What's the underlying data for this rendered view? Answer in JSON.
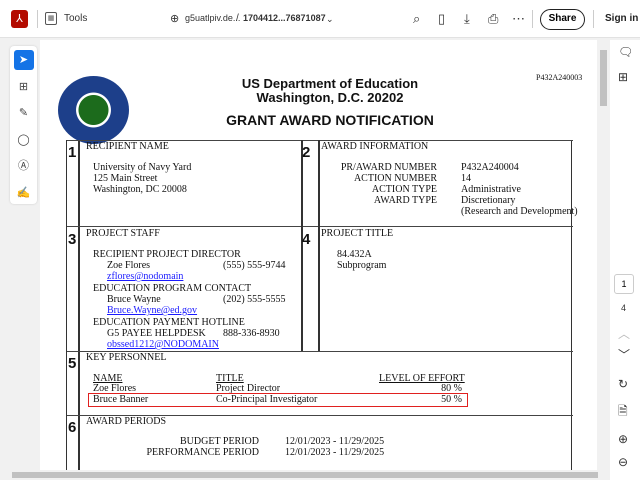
{
  "toolbar": {
    "tools_label": "Tools",
    "domain": "g5uatlpiv.de...",
    "separator": "/",
    "filename": "1704412...76871087",
    "share_label": "Share",
    "signin_label": "Sign in"
  },
  "left_tools": [
    "select",
    "add-comment",
    "draw",
    "lasso",
    "text-select",
    "sign"
  ],
  "document": {
    "code": "P432A240003",
    "agency": "US Department of Education",
    "city": "Washington, D.C. 20202",
    "title": "GRANT AWARD NOTIFICATION",
    "s1": {
      "num": "1",
      "heading": "RECIPIENT NAME",
      "lines": [
        "University of Navy Yard",
        "125 Main Street",
        "Washington, DC 20008"
      ]
    },
    "s2": {
      "num": "2",
      "heading": "AWARD INFORMATION",
      "labels": [
        "PR/AWARD NUMBER",
        "ACTION NUMBER",
        "ACTION TYPE",
        "AWARD TYPE"
      ],
      "values": [
        "P432A240004",
        "14",
        "Administrative",
        "Discretionary",
        "(Research and Development)"
      ]
    },
    "s3": {
      "num": "3",
      "heading": "PROJECT STAFF",
      "director_h": "RECIPIENT PROJECT DIRECTOR",
      "director": "Zoe Flores",
      "director_phone": "(555) 555-9744",
      "director_email": "zflores@nodomain",
      "contact_h": "EDUCATION PROGRAM CONTACT",
      "contact": "Bruce Wayne",
      "contact_phone": "(202) 555-5555",
      "contact_email": "Bruce.Wayne@ed.gov",
      "hotline_h": "EDUCATION PAYMENT HOTLINE",
      "hotline": "G5 PAYEE HELPDESK",
      "hotline_phone": "888-336-8930",
      "hotline_email": "obssed1212@NODOMAIN"
    },
    "s4": {
      "num": "4",
      "heading": "PROJECT TITLE",
      "lines": [
        "84.432A",
        "Subprogram"
      ]
    },
    "s5": {
      "num": "5",
      "heading": "KEY PERSONNEL",
      "cols": [
        "NAME",
        "TITLE",
        "LEVEL OF EFFORT"
      ],
      "rows": [
        [
          "Zoe Flores",
          "Project Director",
          "80 %"
        ],
        [
          "Bruce Banner",
          "Co-Principal Investigator",
          "50 %"
        ]
      ],
      "highlight_color": "#e0201f"
    },
    "s6": {
      "num": "6",
      "heading": "AWARD PERIODS",
      "labels": [
        "BUDGET PERIOD",
        "PERFORMANCE PERIOD"
      ],
      "values": [
        "12/01/2023 - 11/29/2025",
        "12/01/2023 - 11/29/2025"
      ]
    }
  },
  "page_nav": {
    "current": "1",
    "total": "4"
  },
  "colors": {
    "accent": "#1473e6",
    "brand": "#b30b00"
  }
}
